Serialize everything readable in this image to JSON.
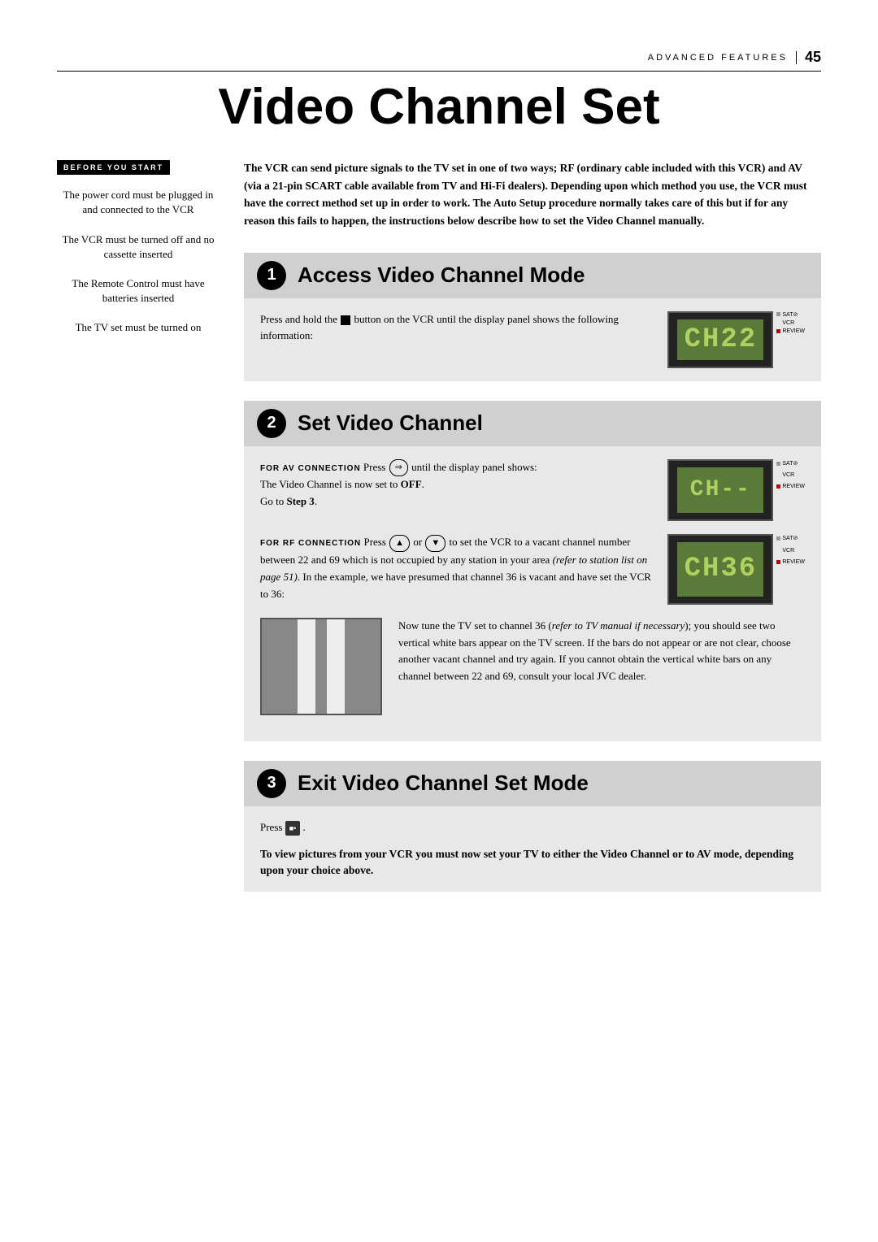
{
  "header": {
    "section_label": "ADVANCED FEATURES",
    "page_number": "45"
  },
  "page_title": "Video Channel Set",
  "sidebar": {
    "before_you_start": "BEFORE YOU START",
    "items": [
      "The power cord must be plugged in and connected to the VCR",
      "The VCR must be turned off and no cassette inserted",
      "The Remote Control must have batteries inserted",
      "The TV set must be turned on"
    ]
  },
  "intro": {
    "text_parts": [
      "The VCR can send picture signals to the TV set in one of two ways; RF (ordinary cable included with this VCR) and AV (via a 21-pin SCART cable available from TV and Hi-Fi dealers). Depending upon which method you use, the VCR must have the correct method set up in order to work. The Auto Setup procedure normally takes care of this but if for any reason this fails to happen, the instructions below describe how to set the Video Channel manually."
    ]
  },
  "steps": [
    {
      "number": "1",
      "title": "Access Video Channel Mode",
      "body_text": "Press and hold the",
      "body_text2": "button on the VCR until the display panel shows the following information:",
      "display": "CH22",
      "display_labels": [
        "SATØ",
        "VCR",
        "REVIEW"
      ]
    },
    {
      "number": "2",
      "title": "Set Video Channel",
      "av_label": "FOR AV CONNECTION",
      "av_text": "Press",
      "av_text2": "until the display panel shows:",
      "av_display": "CH--",
      "av_note1": "The Video Channel is now set to OFF.",
      "av_note2": "Go to Step 3.",
      "rf_label": "FOR RF CONNECTION",
      "rf_text": "Press",
      "rf_text2": "or",
      "rf_text3": "to set the VCR to a vacant channel number between 22 and 69 which is not occupied by any station in your area",
      "rf_italic": "(refer to station list on page 51)",
      "rf_display": "CH36",
      "rf_note": ". In the example, we have presumed that channel 36 is vacant and have set the VCR to 36:",
      "tv_text": "Now tune the TV set to channel 36 (refer to TV manual if necessary); you should see two vertical white bars appear on the TV screen. If the bars do not appear or are not clear, choose another vacant channel and try again. If you cannot obtain the vertical white bars on any channel between 22 and 69, consult your local JVC dealer.",
      "display_labels": [
        "SATØ",
        "VCR",
        "REVIEW"
      ]
    },
    {
      "number": "3",
      "title": "Exit Video Channel Set Mode",
      "press_text": "Press",
      "final_text": "To view pictures from your VCR you must now set your TV to either the Video Channel or to AV mode, depending upon your choice above."
    }
  ]
}
